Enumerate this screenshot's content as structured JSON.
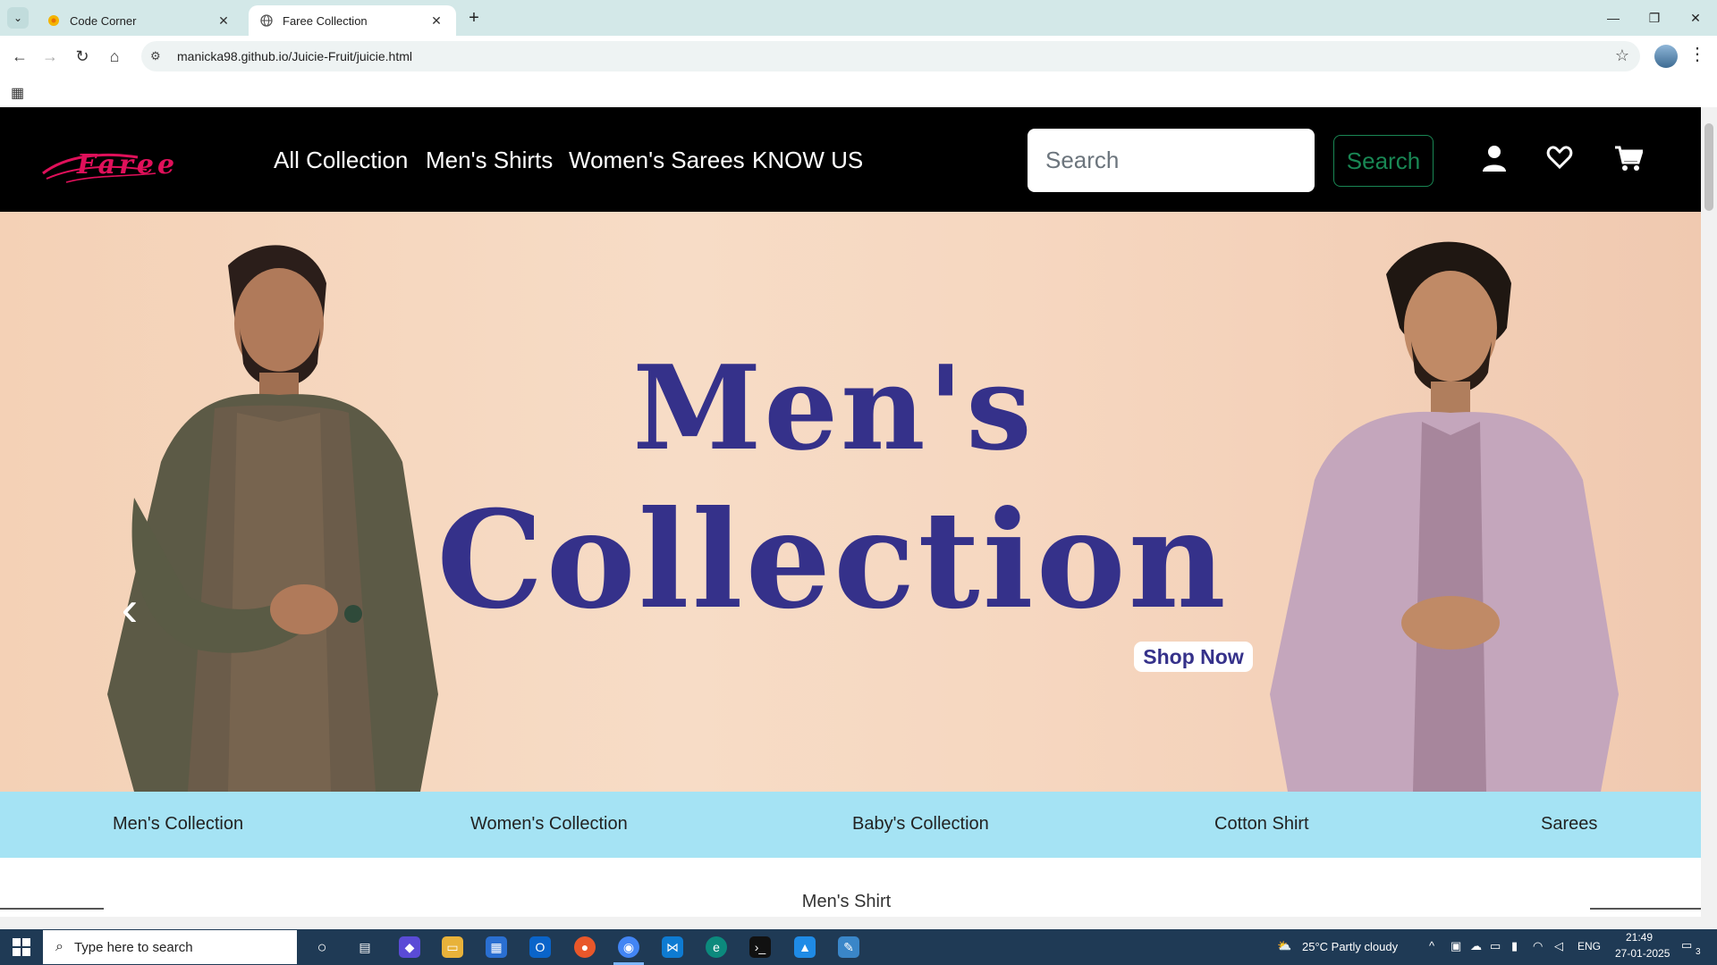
{
  "browser": {
    "tabs": [
      {
        "title": "Code Corner",
        "active": false
      },
      {
        "title": "Faree Collection",
        "active": true
      }
    ],
    "url": "manicka98.github.io/Juicie-Fruit/juicie.html"
  },
  "site": {
    "logo_text": "Faree",
    "nav": [
      "All Collection",
      "Men's Shirts",
      "Women's Sarees",
      "KNOW US"
    ],
    "search_placeholder": "Search",
    "search_button": "Search",
    "header_icons": [
      "user-icon",
      "heart-icon",
      "cart-icon"
    ],
    "hero": {
      "title_line1": "Men's",
      "title_line2": "Collection",
      "cta": "Shop Now"
    },
    "categories": [
      "Men's Collection",
      "Women's Collection",
      "Baby's Collection",
      "Cotton Shirt",
      "Sarees"
    ],
    "section_title": "Men's Shirt"
  },
  "taskbar": {
    "search_placeholder": "Type here to search",
    "weather": "25°C  Partly cloudy",
    "language": "ENG",
    "time": "21:49",
    "date": "27-01-2025",
    "notifications": "3"
  },
  "colors": {
    "hero_text": "#35318a",
    "category_bar": "#a5e3f4",
    "search_button": "#198754"
  }
}
